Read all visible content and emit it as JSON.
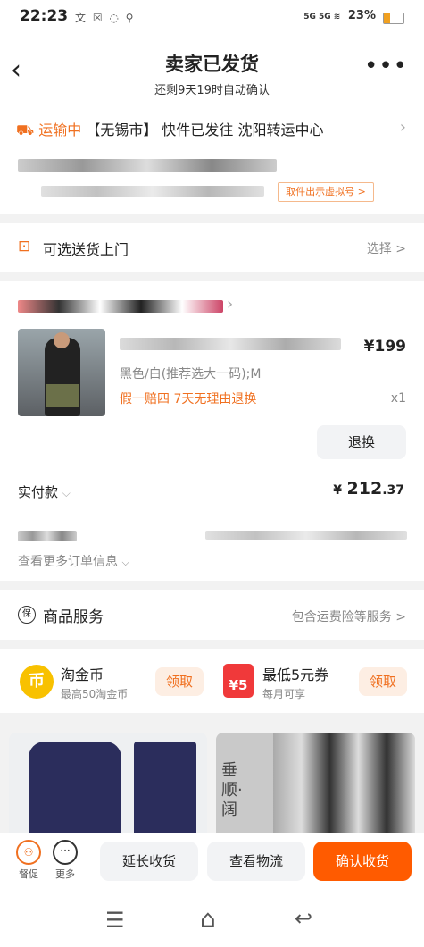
{
  "statusbar": {
    "time": "22:23",
    "icons": "文 ☒ ◌ ⚲",
    "signal": "5G 5G ≋",
    "battery": "23%"
  },
  "header": {
    "title": "卖家已发货",
    "subtitle": "还剩9天19时自动确认",
    "more": "•••"
  },
  "logistics": {
    "status": "运输中",
    "detail": "【无锡市】 快件已发往 沈阳转运中心",
    "pickup_button": "取件出示虚拟号 >"
  },
  "delivery": {
    "label": "可选送货上门",
    "action": "选择 >"
  },
  "product": {
    "price": "¥199",
    "spec": "黑色/白(推荐选大一码);M",
    "guarantee": "假一赔四  7天无理由退换",
    "qty": "x1",
    "refund_button": "退换"
  },
  "payment": {
    "label": "实付款",
    "amount_symbol": "¥",
    "amount_int": "212",
    "amount_dec": ".37",
    "more_info": "查看更多订单信息"
  },
  "service": {
    "label": "商品服务",
    "detail": "包含运费险等服务 >"
  },
  "benefits": [
    {
      "icon_text": "币",
      "title": "淘金币",
      "sub": "最高50淘金币",
      "btn": "领取"
    },
    {
      "icon_text": "¥5",
      "title": "最低5元券",
      "sub": "每月可享",
      "btn": "领取"
    }
  ],
  "bottom": {
    "remind": "督促",
    "more": "更多",
    "extend": "延长收货",
    "track": "查看物流",
    "confirm": "确认收货"
  },
  "nav": {
    "menu": "☰",
    "home": "⌂",
    "back": "↩"
  },
  "rec": {
    "tag": "垂顺·阔"
  }
}
